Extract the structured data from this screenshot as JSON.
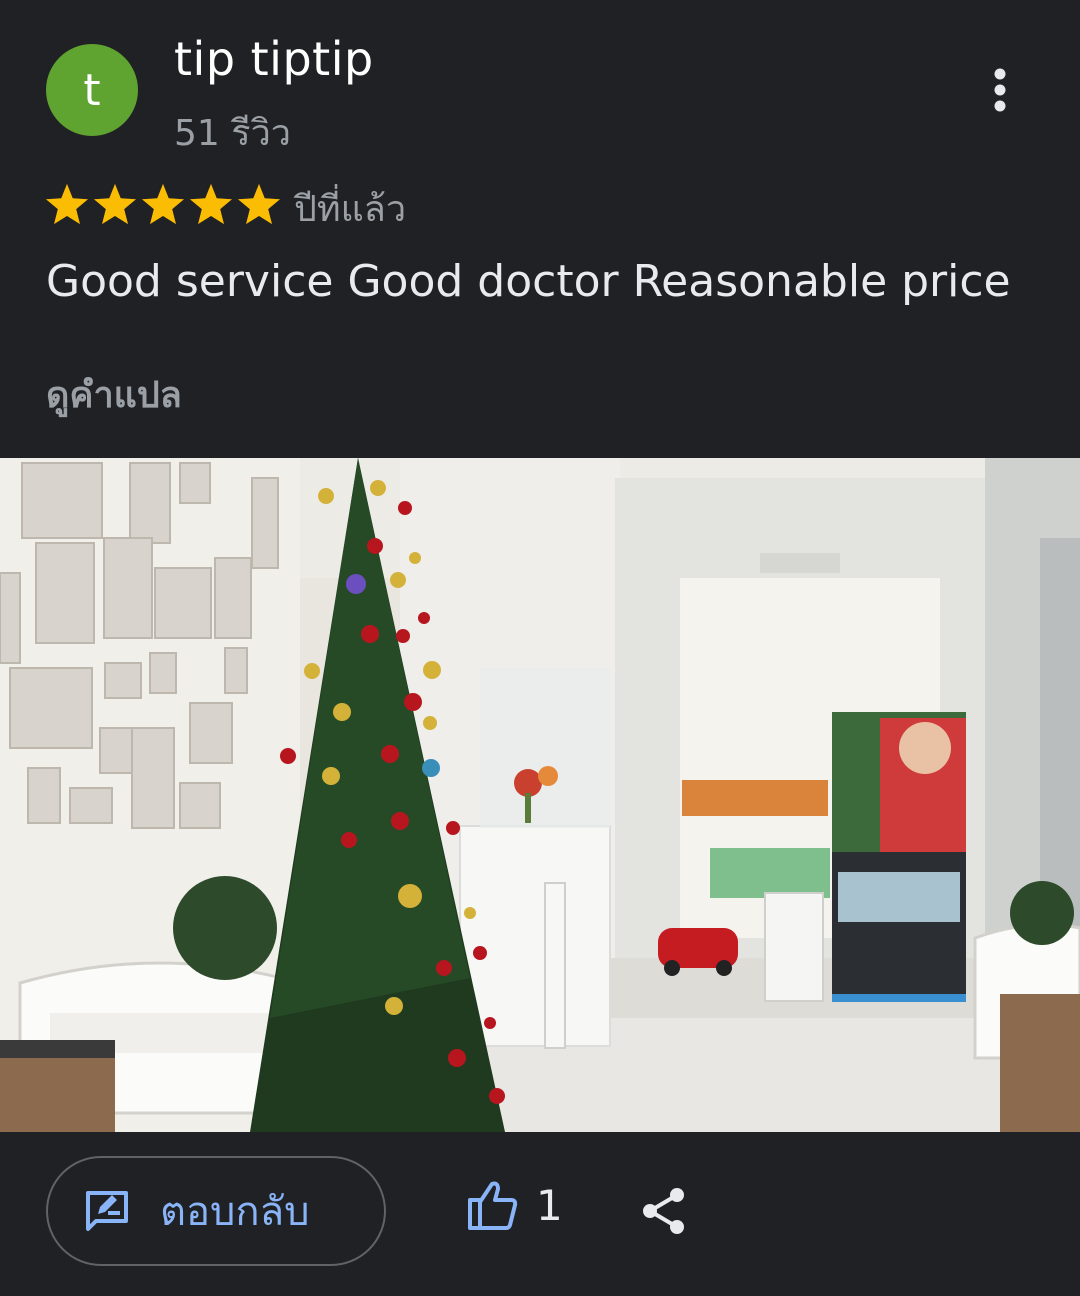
{
  "author": {
    "initial": "t",
    "name": "tip tiptip",
    "review_count": "51 รีวิว",
    "avatar_color": "#5fa330"
  },
  "rating": {
    "stars": 5,
    "max": 5,
    "star_color": "#fbbc04"
  },
  "review": {
    "date": "ปีที่แล้ว",
    "text": "Good service Good doctor Reasonable price",
    "translate_label": "ดูคำแปล"
  },
  "photo": {
    "icon": "dental-clinic-lobby-photo"
  },
  "actions": {
    "reply_label": "ตอบกลับ",
    "like_count": "1",
    "accent_color": "#8ab4f8"
  },
  "icons": {
    "more": "more-vert-icon",
    "reply": "edit-comment-icon",
    "like": "thumb-up-icon",
    "share": "share-icon",
    "star": "star-icon"
  }
}
